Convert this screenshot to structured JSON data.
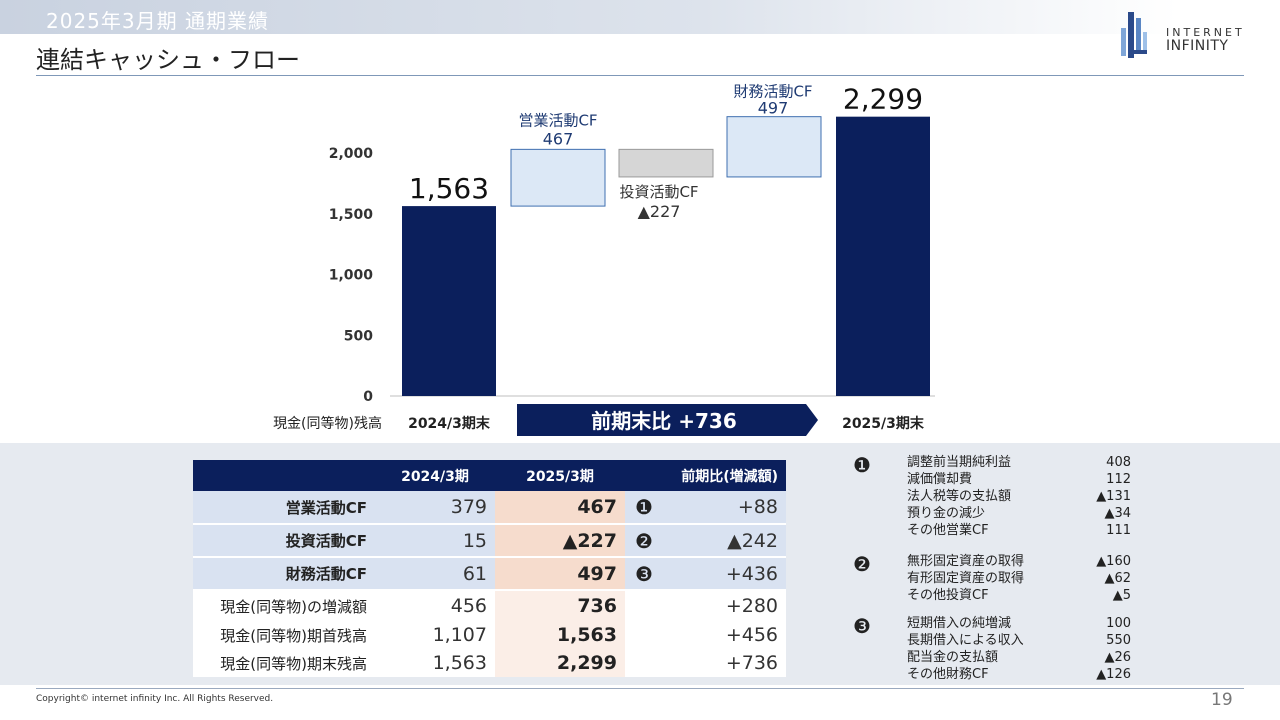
{
  "header": {
    "section_title": "2025年3月期 通期業績",
    "page_title": "連結キャッシュ・フロー"
  },
  "logo": {
    "line1": "INTERNET",
    "line2": "INFINITY"
  },
  "chart_data": {
    "type": "bar",
    "subtype": "waterfall",
    "y_ticks": [
      0,
      500,
      1000,
      1500,
      2000
    ],
    "y_tick_labels": [
      "0",
      "500",
      "1,000",
      "1,500",
      "2,000"
    ],
    "ylim": [
      0,
      2300
    ],
    "row_label": "現金(同等物)残高",
    "categories": [
      "2024/3期末",
      "営業活動CF",
      "投資活動CF",
      "財務活動CF",
      "2025/3期末"
    ],
    "bars": [
      {
        "name": "2024/3期末",
        "kind": "total",
        "start": 0,
        "end": 1563,
        "label": "1,563",
        "color": "#0b1f5c"
      },
      {
        "name": "営業活動CF",
        "kind": "delta",
        "start": 1563,
        "end": 2030,
        "label_name": "営業活動CF",
        "label_value": "467",
        "color": "#dce8f6"
      },
      {
        "name": "投資活動CF",
        "kind": "delta",
        "start": 2030,
        "end": 1803,
        "label_name": "投資活動CF",
        "label_value": "▲227",
        "color": "#d6d6d6"
      },
      {
        "name": "財務活動CF",
        "kind": "delta",
        "start": 1803,
        "end": 2299,
        "label_name": "財務活動CF",
        "label_value": "497",
        "color": "#dce8f6"
      },
      {
        "name": "2025/3期末",
        "kind": "total",
        "start": 0,
        "end": 2299,
        "label": "2,299",
        "color": "#0b1f5c"
      }
    ],
    "x_labels": [
      "2024/3期末",
      "2025/3期末"
    ],
    "change_banner": {
      "label": "前期末比",
      "value": "+736"
    }
  },
  "table": {
    "headers": [
      "",
      "2024/3期",
      "2025/3期",
      "",
      "前期比(増減額)"
    ],
    "rows": [
      {
        "label": "営業活動CF",
        "y1": "379",
        "y2": "467",
        "mark": "❶",
        "diff": "+88",
        "type": "cf"
      },
      {
        "label": "投資活動CF",
        "y1": "15",
        "y2": "▲227",
        "mark": "❷",
        "diff": "▲242",
        "type": "cf"
      },
      {
        "label": "財務活動CF",
        "y1": "61",
        "y2": "497",
        "mark": "❸",
        "diff": "+436",
        "type": "cf"
      },
      {
        "label": "現金(同等物)の増減額",
        "y1": "456",
        "y2": "736",
        "mark": "",
        "diff": "+280",
        "type": "sub"
      },
      {
        "label": "現金(同等物)期首残高",
        "y1": "1,107",
        "y2": "1,563",
        "mark": "",
        "diff": "+456",
        "type": "sub"
      },
      {
        "label": "現金(同等物)期末残高",
        "y1": "1,563",
        "y2": "2,299",
        "mark": "",
        "diff": "+736",
        "type": "sub"
      }
    ]
  },
  "details": [
    {
      "mark": "❶",
      "items": [
        {
          "label": "調整前当期純利益",
          "value": "408"
        },
        {
          "label": "減価償却費",
          "value": "112"
        },
        {
          "label": "法人税等の支払額",
          "value": "▲131"
        },
        {
          "label": "預り金の減少",
          "value": "▲34"
        },
        {
          "label": "その他営業CF",
          "value": "111"
        }
      ]
    },
    {
      "mark": "❷",
      "items": [
        {
          "label": "無形固定資産の取得",
          "value": "▲160"
        },
        {
          "label": "有形固定資産の取得",
          "value": "▲62"
        },
        {
          "label": "その他投資CF",
          "value": "▲5"
        }
      ]
    },
    {
      "mark": "❸",
      "items": [
        {
          "label": "短期借入の純増減",
          "value": "100"
        },
        {
          "label": "長期借入による収入",
          "value": "550"
        },
        {
          "label": "配当金の支払額",
          "value": "▲26"
        },
        {
          "label": "その他財務CF",
          "value": "▲126"
        }
      ]
    }
  ],
  "footer": {
    "copyright": "Copyright© internet infinity Inc. All Rights Reserved.",
    "page_number": "19"
  },
  "colors": {
    "navy": "#0b1f5c",
    "light_blue": "#dce8f6",
    "gray": "#d6d6d6",
    "label_blue": "#1f3b73"
  }
}
